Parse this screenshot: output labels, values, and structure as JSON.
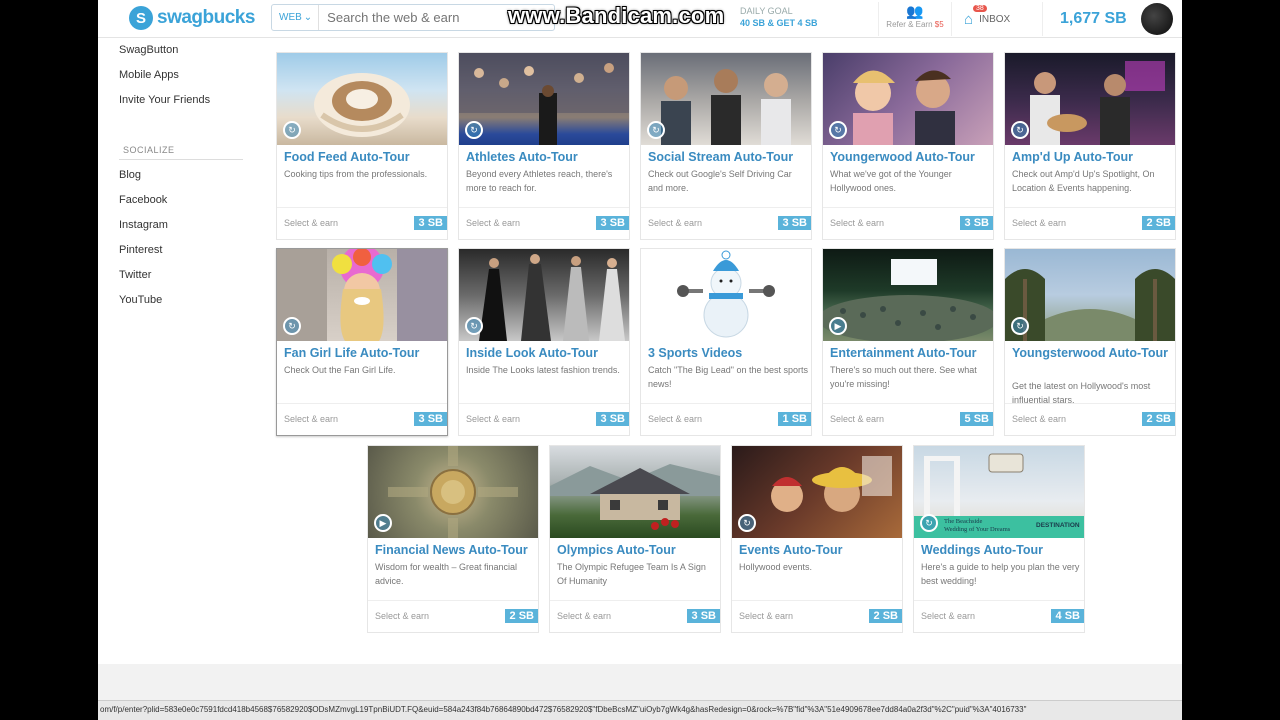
{
  "watermark": "www.Bandicam.com",
  "header": {
    "logo_text": "swagbucks",
    "search_scope": "WEB",
    "search_placeholder": "Search the web & earn",
    "goal_label": "DAILY GOAL",
    "goal_value": "40 SB & GET 4 SB",
    "refer_label": "Refer & Earn",
    "refer_amount": "$5",
    "inbox_label": "INBOX",
    "inbox_count": "38",
    "balance": "1,677 SB"
  },
  "sidebar": {
    "links": [
      "SwagButton",
      "Mobile Apps",
      "Invite Your Friends"
    ],
    "section_title": "SOCIALIZE",
    "social": [
      "Blog",
      "Facebook",
      "Instagram",
      "Pinterest",
      "Twitter",
      "YouTube"
    ]
  },
  "cards": [
    {
      "title": "Food Feed Auto-Tour",
      "desc": "Cooking tips from the professionals.",
      "cta": "Select & earn",
      "sb": "3 SB",
      "icon": "refresh-icon"
    },
    {
      "title": "Athletes Auto-Tour",
      "desc": "Beyond every Athletes reach, there's more to reach for.",
      "cta": "Select & earn",
      "sb": "3 SB",
      "icon": "refresh-icon"
    },
    {
      "title": "Social Stream Auto-Tour",
      "desc": "Check out Google's Self Driving Car and more.",
      "cta": "Select & earn",
      "sb": "3 SB",
      "icon": "refresh-icon"
    },
    {
      "title": "Youngerwood Auto-Tour",
      "desc": "What we've got of the Younger Hollywood ones.",
      "cta": "Select & earn",
      "sb": "3 SB",
      "icon": "refresh-icon"
    },
    {
      "title": "Amp'd Up Auto-Tour",
      "desc": "Check out Amp'd Up's Spotlight, On Location & Events happening.",
      "cta": "Select & earn",
      "sb": "2 SB",
      "icon": "refresh-icon"
    },
    {
      "title": "Fan Girl Life Auto-Tour",
      "desc": "Check Out the Fan Girl Life.",
      "cta": "Select & earn",
      "sb": "3 SB",
      "icon": "refresh-icon"
    },
    {
      "title": "Inside Look Auto-Tour",
      "desc": "Inside The Looks latest fashion trends.",
      "cta": "Select & earn",
      "sb": "3 SB",
      "icon": "refresh-icon"
    },
    {
      "title": "3 Sports Videos",
      "desc": "Catch \"The Big Lead\" on the best sports news!",
      "cta": "Select & earn",
      "sb": "1 SB",
      "icon": ""
    },
    {
      "title": "Entertainment Auto-Tour",
      "desc": "There's so much out there. See what you're missing!",
      "cta": "Select & earn",
      "sb": "5 SB",
      "icon": "play-icon"
    },
    {
      "title": "Youngsterwood Auto-Tour",
      "desc": "Get the latest on Hollywood's most influential stars.",
      "cta": "Select & earn",
      "sb": "2 SB",
      "icon": "refresh-icon"
    },
    {
      "title": "Financial News Auto-Tour",
      "desc": "Wisdom for wealth – Great financial advice.",
      "cta": "Select & earn",
      "sb": "2 SB",
      "icon": "play-icon"
    },
    {
      "title": "Olympics Auto-Tour",
      "desc": "The Olympic Refugee Team Is A Sign Of Humanity",
      "cta": "Select & earn",
      "sb": "3 SB",
      "icon": ""
    },
    {
      "title": "Events Auto-Tour",
      "desc": "Hollywood events.",
      "cta": "Select & earn",
      "sb": "2 SB",
      "icon": "refresh-icon"
    },
    {
      "title": "Weddings Auto-Tour",
      "desc": "Here's a guide to help you plan the very best wedding!",
      "cta": "Select & earn",
      "sb": "4 SB",
      "icon": "refresh-icon",
      "img_caption_1": "The Beachside",
      "img_caption_2": "Wedding of Your Dreams",
      "img_caption_3": "DESTINATION"
    }
  ],
  "status_url": "om/f/p/enter?plid=583e0e0c7591fdcd418b4568$76582920$ODsMZmvgL19TpnBiUDT.FQ&euid=584a243f84b76864890bd472$76582920$\"fDbeBcsMZ\"uiOyb7gWk4g&hasRedesign=0&rock=%7B\"fid\"%3A\"51e4909678ee7dd84a0a2f3d\"%2C\"puid\"%3A\"4016733\""
}
